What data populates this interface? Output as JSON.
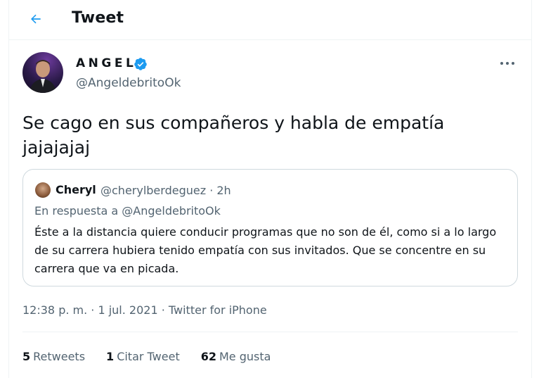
{
  "header": {
    "title": "Tweet"
  },
  "tweet": {
    "author_name": "ANGEL",
    "author_handle": "@AngeldebritoOk",
    "text": "Se cago en sus compañeros  y habla de empatía\njajajajaj",
    "timestamp": "12:38 p. m. · 1 jul. 2021 · Twitter for iPhone"
  },
  "quote": {
    "author_name": "Cheryl",
    "meta": "@cherylberdeguez · 2h",
    "reply_prefix": "En respuesta a",
    "reply_mention": "@AngeldebritoOk",
    "text": "Éste a la distancia quiere conducir programas que no son de él, como si a lo largo\nde su carrera hubiera tenido empatía con sus invitados. Que se concentre en su\ncarrera que va en picada."
  },
  "stats": {
    "retweets_count": "5",
    "retweets_label": "Retweets",
    "quotes_count": "1",
    "quotes_label": "Citar Tweet",
    "likes_count": "62",
    "likes_label": "Me gusta"
  },
  "colors": {
    "accent": "#1d9bf0",
    "text_primary": "#0f1419",
    "text_secondary": "#536471",
    "border": "#cfd9de"
  },
  "icons": {
    "back": "arrow-left-icon",
    "verified": "verified-badge-icon",
    "more": "more-horizontal-icon"
  }
}
